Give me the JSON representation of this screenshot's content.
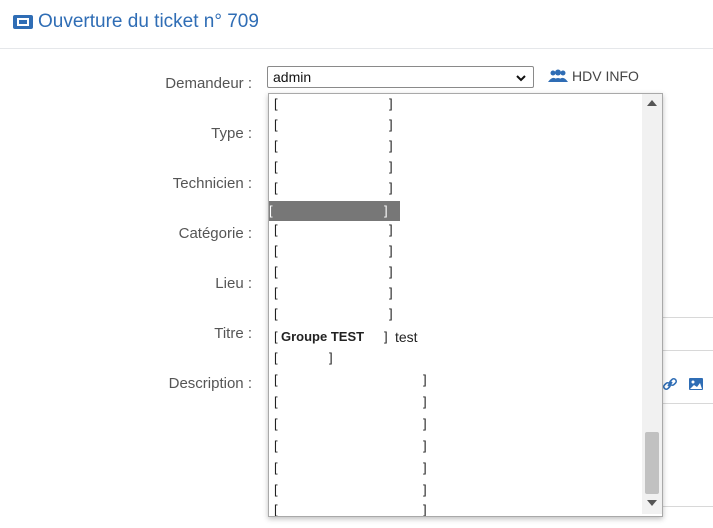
{
  "header": {
    "title": "Ouverture du ticket n° 709"
  },
  "labels": {
    "demandeur": "Demandeur :",
    "type": "Type :",
    "technicien": "Technicien :",
    "categorie": "Catégorie :",
    "lieu": "Lieu :",
    "titre": "Titre :",
    "description": "Description :"
  },
  "demandeur_select": {
    "value": "admin"
  },
  "hdv_info": {
    "label": "HDV INFO"
  },
  "dropdown": {
    "bracket_open": "[",
    "bracket_close": "]",
    "group_label": "Groupe TEST",
    "group_suffix": "test"
  },
  "colors": {
    "accent": "#2f6db5",
    "highlight": "#777777"
  }
}
